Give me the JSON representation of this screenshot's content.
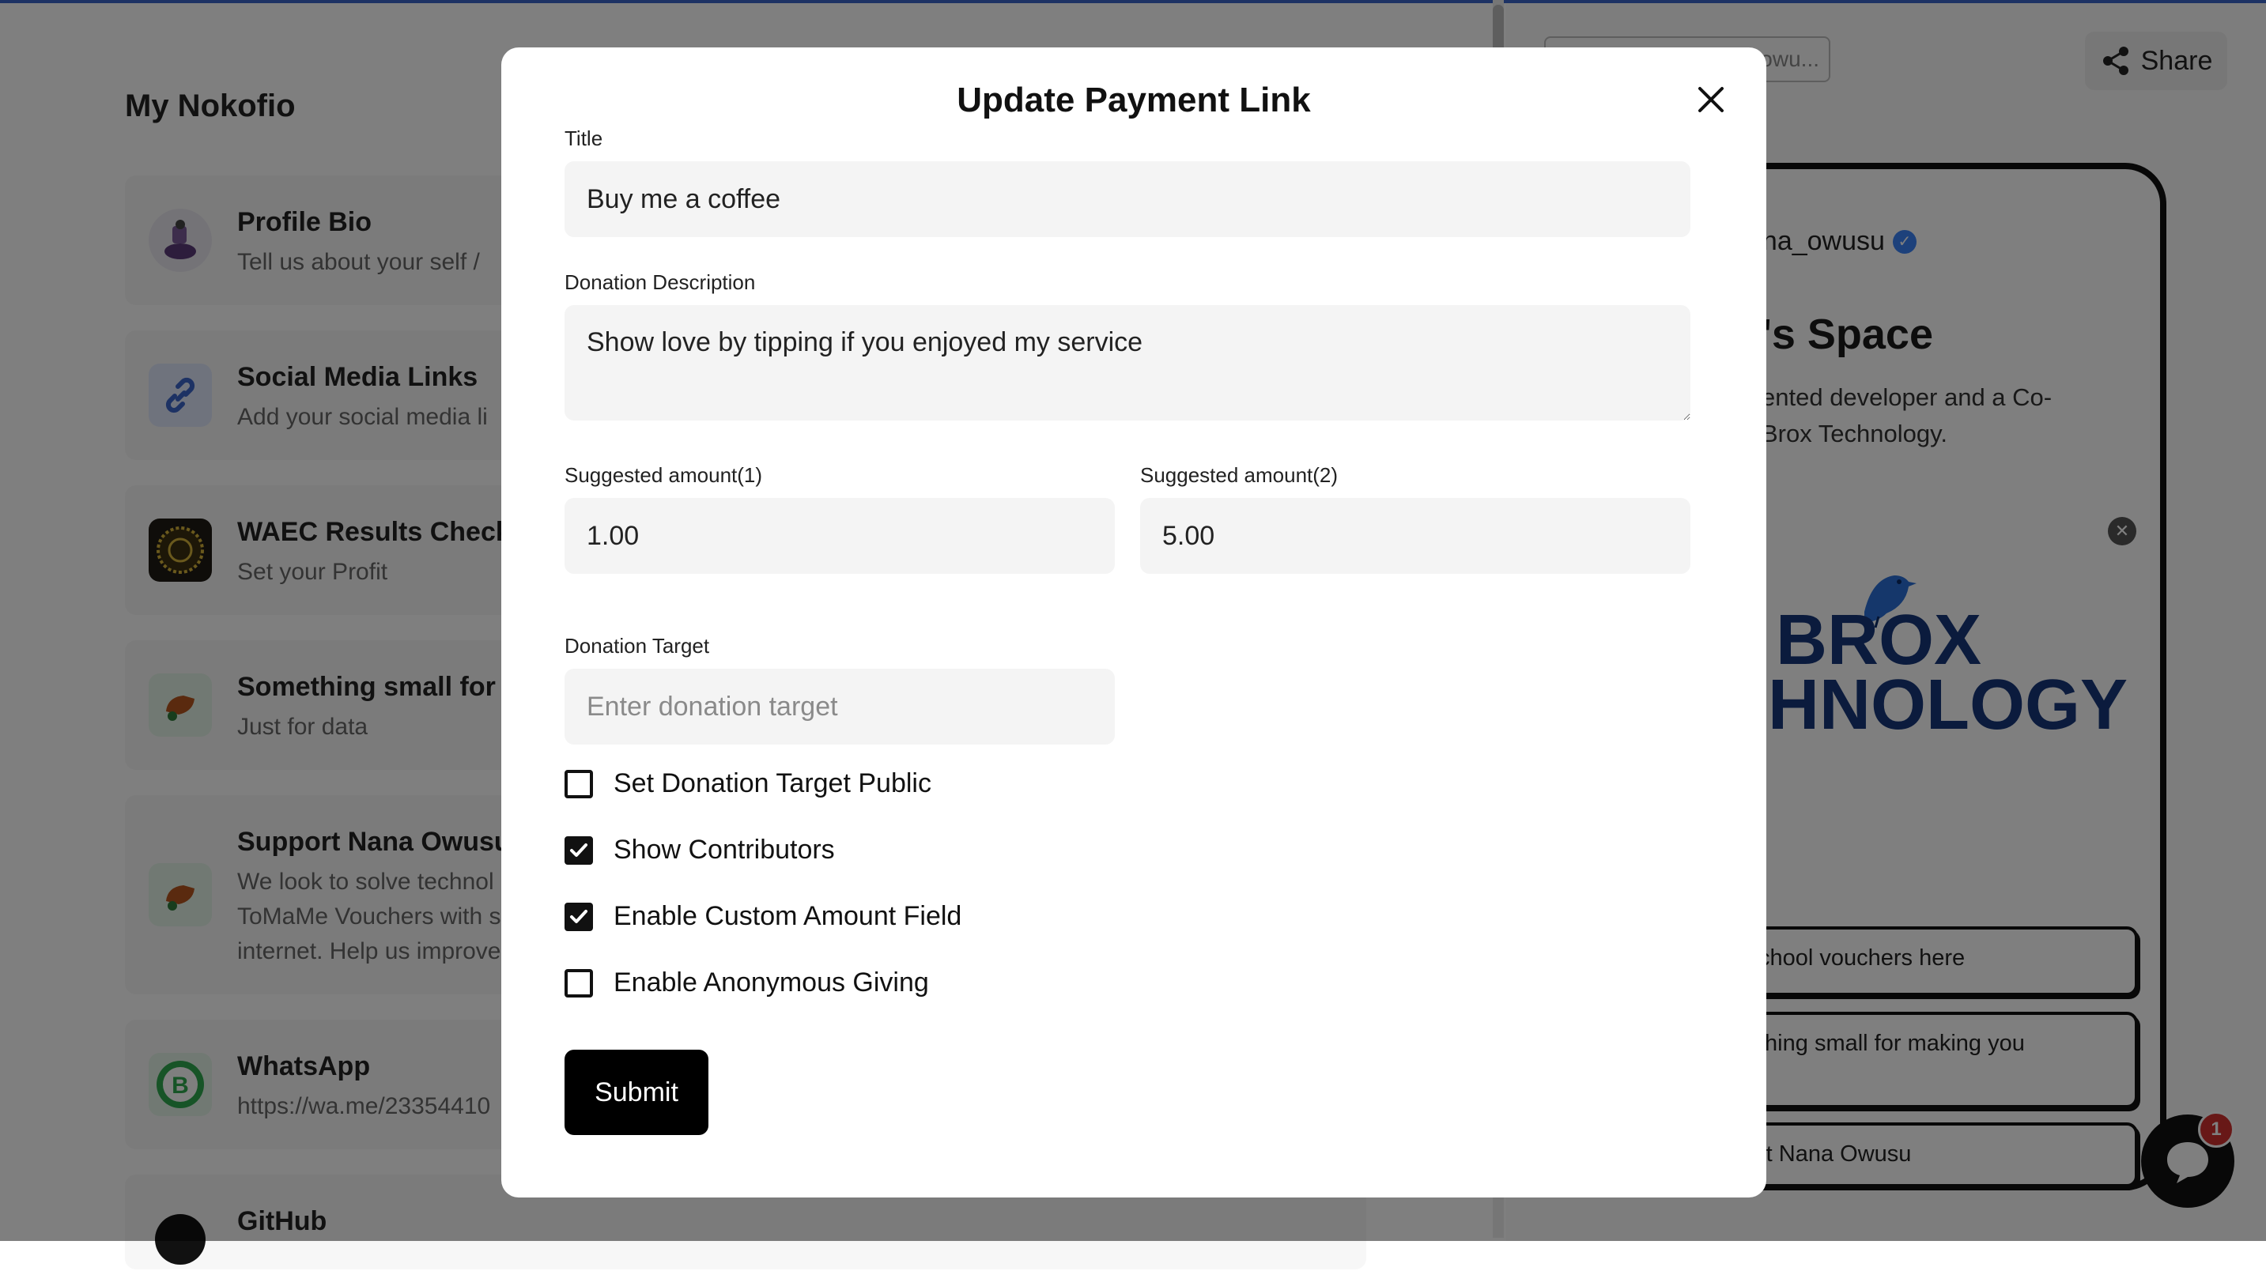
{
  "background": {
    "page_title": "My Nokofio",
    "cards": [
      {
        "title": "Profile Bio",
        "sub": [
          "Tell us about your self / "
        ]
      },
      {
        "title": "Social Media Links",
        "sub": [
          "Add your social media li"
        ]
      },
      {
        "title": "WAEC Results Check",
        "sub": [
          "Set your Profit"
        ]
      },
      {
        "title": "Something small for",
        "sub": [
          "Just for data"
        ]
      },
      {
        "title": "Support Nana Owusu",
        "sub": [
          "We look to solve technol",
          "ToMaMe Vouchers with s",
          "internet. Help us improve"
        ]
      },
      {
        "title": "WhatsApp",
        "sub": [
          "https://wa.me/23354410"
        ]
      },
      {
        "title": "GitHub",
        "sub": []
      }
    ],
    "url_fragment": "owu...",
    "share_label": "Share",
    "preview": {
      "handle": "ana_owusu",
      "space_title": "'s Space",
      "bio_lines": [
        "ented developer and a Co-",
        "Brox Technology."
      ],
      "logo_line1": "BROX",
      "logo_line2": "HNOLOGY",
      "links": [
        "chool vouchers here",
        "thing small for making you",
        "rt Nana Owusu"
      ]
    },
    "chat_badge": "1"
  },
  "modal": {
    "title": "Update Payment Link",
    "title_field": {
      "label": "Title",
      "value": "Buy me a coffee"
    },
    "description_field": {
      "label": "Donation Description",
      "value": "Show love by tipping if you enjoyed my service"
    },
    "amount1": {
      "label": "Suggested amount(1)",
      "value": "1.00"
    },
    "amount2": {
      "label": "Suggested amount(2)",
      "value": "5.00"
    },
    "target": {
      "label": "Donation Target",
      "placeholder": "Enter donation target",
      "value": ""
    },
    "checkboxes": [
      {
        "label": "Set Donation Target Public",
        "checked": false
      },
      {
        "label": "Show Contributors",
        "checked": true
      },
      {
        "label": "Enable Custom Amount Field",
        "checked": true
      },
      {
        "label": "Enable Anonymous Giving",
        "checked": false
      }
    ],
    "submit_label": "Submit"
  },
  "colors": {
    "accent": "#000000",
    "top_line": "#3a64c8",
    "verified": "#3b82f6",
    "badge": "#d0302f"
  }
}
